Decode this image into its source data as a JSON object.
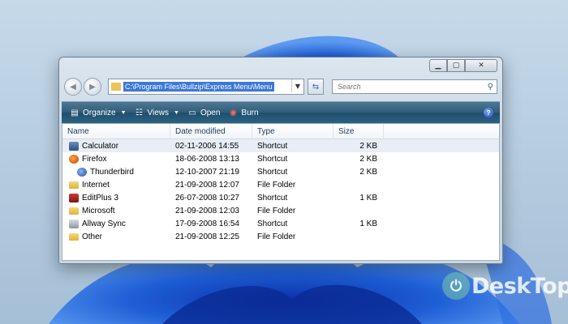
{
  "window": {
    "address_path": "C:\\Program Files\\Bullzip\\Express Menu\\Menu",
    "search_placeholder": "Search"
  },
  "toolbar": {
    "organize": "Organize",
    "views": "Views",
    "open": "Open",
    "burn": "Burn"
  },
  "columns": {
    "name": "Name",
    "date": "Date modified",
    "type": "Type",
    "size": "Size"
  },
  "files": [
    {
      "name": "Calculator",
      "date": "02-11-2006 14:55",
      "type": "Shortcut",
      "size": "2 KB",
      "icon": "calculator-icon"
    },
    {
      "name": "Firefox",
      "date": "18-06-2008 13:13",
      "type": "Shortcut",
      "size": "2 KB",
      "icon": "firefox-icon"
    },
    {
      "name": "Thunderbird",
      "date": "12-10-2007 21:19",
      "type": "Shortcut",
      "size": "2 KB",
      "icon": "thunderbird-icon"
    },
    {
      "name": "Internet",
      "date": "21-09-2008 12:07",
      "type": "File Folder",
      "size": "",
      "icon": "folder-icon"
    },
    {
      "name": "EditPlus 3",
      "date": "26-07-2008 10:27",
      "type": "Shortcut",
      "size": "1 KB",
      "icon": "editplus-icon"
    },
    {
      "name": "Microsoft",
      "date": "21-09-2008 12:03",
      "type": "File Folder",
      "size": "",
      "icon": "folder-icon"
    },
    {
      "name": "Allway Sync",
      "date": "17-09-2008 16:54",
      "type": "Shortcut",
      "size": "1 KB",
      "icon": "allwaysync-icon"
    },
    {
      "name": "Other",
      "date": "21-09-2008 12:25",
      "type": "File Folder",
      "size": "",
      "icon": "folder-icon"
    }
  ],
  "watermark": "DeskTop",
  "colors": {
    "toolbar": "#2f5c79",
    "selection": "#3c78d8",
    "wallpaper_bloom": "#1f5fd6"
  }
}
